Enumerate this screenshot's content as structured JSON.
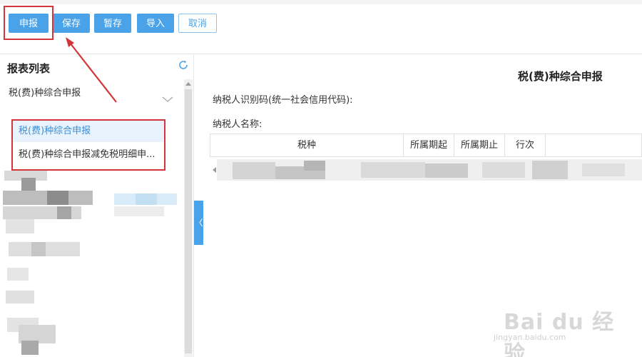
{
  "toolbar": {
    "declare_label": "申报",
    "save_label": "保存",
    "draft_label": "暂存",
    "import_label": "导入",
    "cancel_label": "取消"
  },
  "sidebar": {
    "title": "报表列表",
    "category": "税(费)种综合申报",
    "items": [
      {
        "label": "税(费)种综合申报"
      },
      {
        "label": "税(费)种综合申报减免税明细申..."
      }
    ]
  },
  "main": {
    "form_title": "税(费)种综合申报",
    "taxpayer_id_label": "纳税人识别码(统一社会信用代码):",
    "taxpayer_name_label": "纳税人名称:",
    "columns": [
      "税种",
      "所属期起",
      "所属期止",
      "行次"
    ]
  },
  "collapse_glyph": "〈",
  "watermark": {
    "brand": "Bai du 经验",
    "url": "jingyan.baidu.com"
  },
  "colors": {
    "accent": "#4aa3e8",
    "highlight": "#d3363a"
  },
  "icons": {
    "refresh": "refresh-icon",
    "chevron": "chevron-down-icon"
  }
}
